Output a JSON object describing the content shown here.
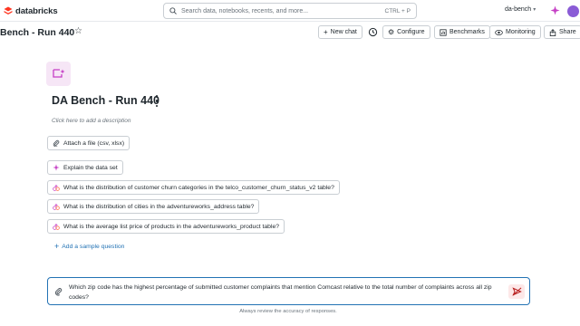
{
  "app": {
    "logo_text": "databricks",
    "workspace": "da-bench"
  },
  "search": {
    "placeholder": "Search data, notebooks, recents, and more...",
    "shortcut": "CTRL + P"
  },
  "header": {
    "title": "Bench - Run 440",
    "buttons": {
      "new_chat": "New chat",
      "configure": "Configure",
      "benchmarks": "Benchmarks",
      "monitoring": "Monitoring",
      "share": "Share"
    }
  },
  "space": {
    "title": "DA Bench - Run 440",
    "description_placeholder": "Click here to add a description"
  },
  "actions": {
    "attach": "Attach a file (csv, xlsx)",
    "explain": "Explain the data set"
  },
  "sample_questions": [
    "What is the distribution of customer churn categories in the telco_customer_churn_status_v2 table?",
    "What is the distribution of cities in the adventureworks_address table?",
    "What is the average list price of products in the adventureworks_product table?"
  ],
  "add_sample": "Add a sample question",
  "chat_input": {
    "value": "Which zip code has the highest percentage of submitted customer complaints that mention Comcast relative to the total number of complaints across all zip codes?"
  },
  "footer": "Always review the accuracy of responses.",
  "colors": {
    "brand": "#ff3621",
    "accent": "#2272b4",
    "ai": "#c53fc5"
  }
}
